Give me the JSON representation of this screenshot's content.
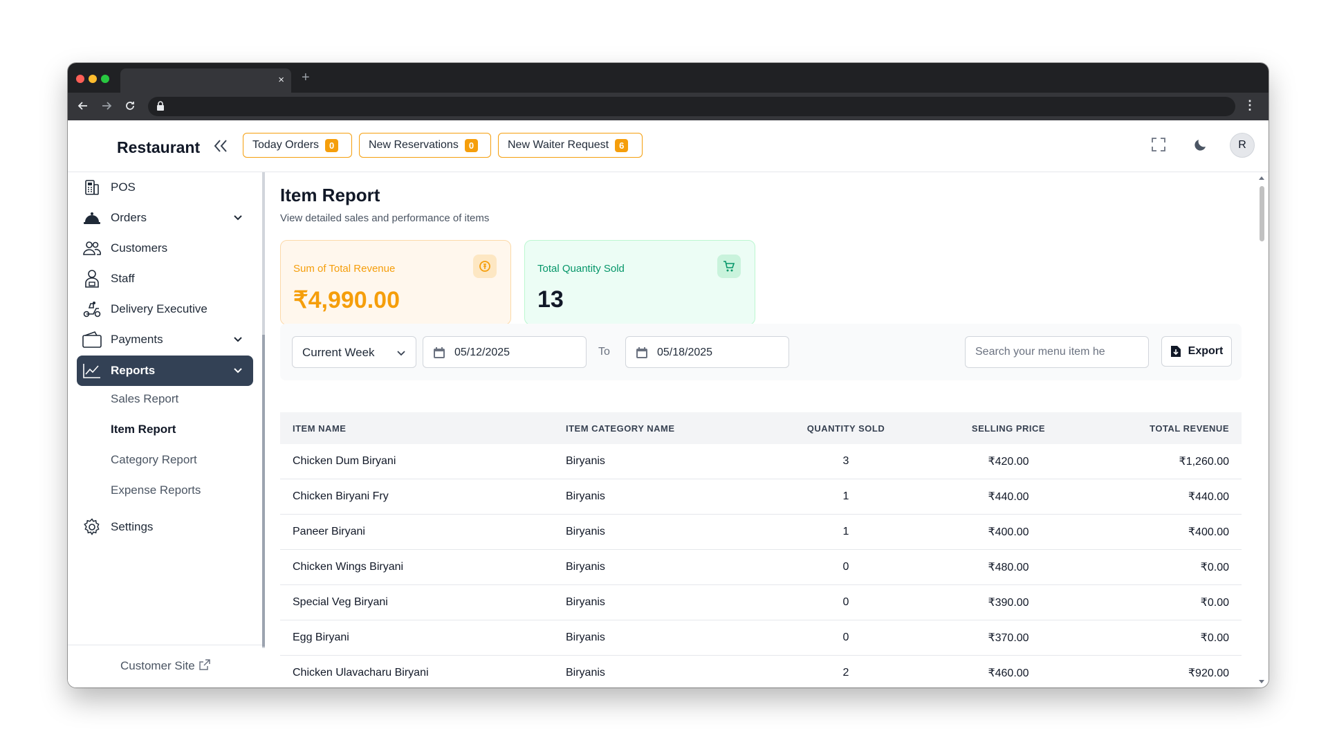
{
  "browser": {
    "tab_close": "×",
    "new_tab": "+",
    "menu": "⋮"
  },
  "header": {
    "brand": "Restaurant",
    "chips": [
      {
        "label": "Today Orders",
        "count": "0"
      },
      {
        "label": "New Reservations",
        "count": "0"
      },
      {
        "label": "New Waiter Request",
        "count": "6"
      }
    ],
    "avatar_initial": "R"
  },
  "sidebar": {
    "items": [
      {
        "label": "POS",
        "icon": "pos-icon"
      },
      {
        "label": "Orders",
        "icon": "service-bell-icon",
        "expandable": true
      },
      {
        "label": "Customers",
        "icon": "users-icon"
      },
      {
        "label": "Staff",
        "icon": "staff-icon"
      },
      {
        "label": "Delivery Executive",
        "icon": "delivery-scooter-icon"
      },
      {
        "label": "Payments",
        "icon": "wallet-icon",
        "expandable": true
      },
      {
        "label": "Reports",
        "icon": "chart-line-icon",
        "expandable": true,
        "active": true
      },
      {
        "label": "Settings",
        "icon": "gear-icon"
      }
    ],
    "report_subitems": [
      {
        "label": "Sales Report"
      },
      {
        "label": "Item Report",
        "current": true
      },
      {
        "label": "Category Report"
      },
      {
        "label": "Expense Reports"
      }
    ],
    "footer_link": "Customer Site"
  },
  "main": {
    "title": "Item Report",
    "subtitle": "View detailed sales and performance of items",
    "cards": [
      {
        "label": "Sum of Total Revenue",
        "value": "₹4,990.00",
        "color": "#f59e0b",
        "bg": "#fff7ed",
        "border": "#fcd9a8"
      },
      {
        "label": "Total Quantity Sold",
        "value": "13",
        "color": "#059669",
        "bg": "#ecfdf5",
        "border": "#bbf7d0"
      }
    ],
    "filters": {
      "period": "Current Week",
      "start_date": "05/12/2025",
      "to_label": "To",
      "end_date": "05/18/2025",
      "search_placeholder": "Search your menu item he",
      "export_label": "Export"
    },
    "table": {
      "columns": [
        "ITEM NAME",
        "ITEM CATEGORY NAME",
        "QUANTITY SOLD",
        "SELLING PRICE",
        "TOTAL REVENUE"
      ],
      "rows": [
        [
          "Chicken Dum Biryani",
          "Biryanis",
          "3",
          "₹420.00",
          "₹1,260.00"
        ],
        [
          "Chicken Biryani Fry",
          "Biryanis",
          "1",
          "₹440.00",
          "₹440.00"
        ],
        [
          "Paneer Biryani",
          "Biryanis",
          "1",
          "₹400.00",
          "₹400.00"
        ],
        [
          "Chicken Wings Biryani",
          "Biryanis",
          "0",
          "₹480.00",
          "₹0.00"
        ],
        [
          "Special Veg Biryani",
          "Biryanis",
          "0",
          "₹390.00",
          "₹0.00"
        ],
        [
          "Egg Biryani",
          "Biryanis",
          "0",
          "₹370.00",
          "₹0.00"
        ],
        [
          "Chicken Ulavacharu Biryani",
          "Biryanis",
          "2",
          "₹460.00",
          "₹920.00"
        ]
      ]
    }
  },
  "colors": {
    "accent": "#f59e0b",
    "nav_active": "#334155"
  }
}
